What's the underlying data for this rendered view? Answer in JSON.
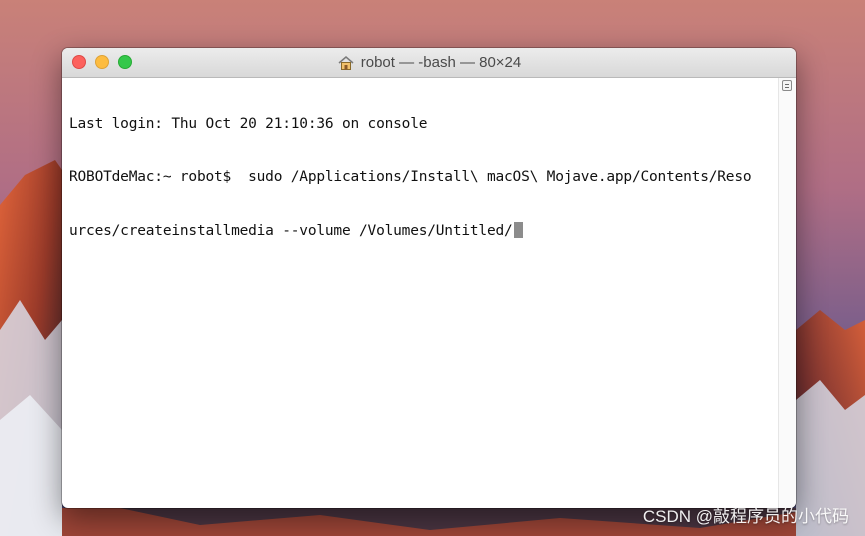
{
  "window": {
    "title": "robot — -bash — 80×24",
    "title_icon": "home-icon"
  },
  "terminal": {
    "lines": [
      "Last login: Thu Oct 20 21:10:36 on console",
      "ROBOTdeMac:~ robot$  sudo /Applications/Install\\ macOS\\ Mojave.app/Contents/Reso",
      "urces/createinstallmedia --volume /Volumes/Untitled/"
    ]
  },
  "watermark": "CSDN @敲程序员的小代码",
  "colors": {
    "close": "#fc615d",
    "minimize": "#fdbc40",
    "zoom": "#34c84a",
    "cursor": "#8c8c8c"
  }
}
